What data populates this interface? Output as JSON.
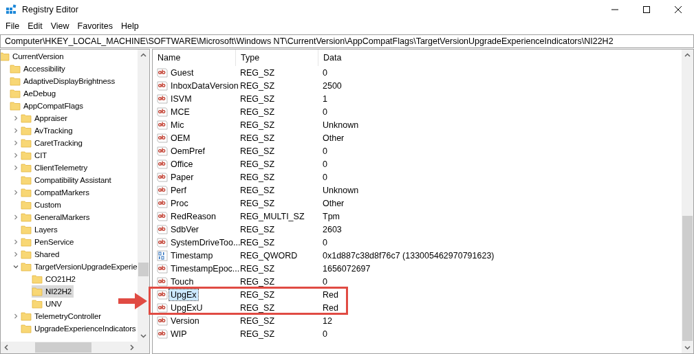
{
  "window": {
    "title": "Registry Editor"
  },
  "menu": [
    "File",
    "Edit",
    "View",
    "Favorites",
    "Help"
  ],
  "address": "Computer\\HKEY_LOCAL_MACHINE\\SOFTWARE\\Microsoft\\Windows NT\\CurrentVersion\\AppCompatFlags\\TargetVersionUpgradeExperienceIndicators\\NI22H2",
  "tree": [
    {
      "label": "CurrentVersion",
      "kind": "plain",
      "selected": false,
      "children": [
        {
          "label": "Accessibility",
          "kind": "plain",
          "selected": false
        },
        {
          "label": "AdaptiveDisplayBrightness",
          "kind": "plain",
          "selected": false
        },
        {
          "label": "AeDebug",
          "kind": "plain",
          "selected": false
        },
        {
          "label": "AppCompatFlags",
          "kind": "plain",
          "selected": false,
          "children": [
            {
              "label": "Appraiser",
              "kind": "branch",
              "expanded": false,
              "selected": false
            },
            {
              "label": "AvTracking",
              "kind": "branch",
              "expanded": false,
              "selected": false
            },
            {
              "label": "CaretTracking",
              "kind": "branch",
              "expanded": false,
              "selected": false
            },
            {
              "label": "CIT",
              "kind": "branch",
              "expanded": false,
              "selected": false
            },
            {
              "label": "ClientTelemetry",
              "kind": "branch",
              "expanded": false,
              "selected": false
            },
            {
              "label": "Compatibility Assistant",
              "kind": "plain",
              "selected": false
            },
            {
              "label": "CompatMarkers",
              "kind": "branch",
              "expanded": false,
              "selected": false
            },
            {
              "label": "Custom",
              "kind": "plain",
              "selected": false
            },
            {
              "label": "GeneralMarkers",
              "kind": "branch",
              "expanded": false,
              "selected": false
            },
            {
              "label": "Layers",
              "kind": "plain",
              "selected": false
            },
            {
              "label": "PenService",
              "kind": "branch",
              "expanded": false,
              "selected": false
            },
            {
              "label": "Shared",
              "kind": "branch",
              "expanded": false,
              "selected": false
            },
            {
              "label": "TargetVersionUpgradeExperie",
              "kind": "branch",
              "expanded": true,
              "selected": false,
              "children": [
                {
                  "label": "CO21H2",
                  "kind": "plain",
                  "selected": false
                },
                {
                  "label": "NI22H2",
                  "kind": "plain",
                  "selected": true
                },
                {
                  "label": "UNV",
                  "kind": "plain",
                  "selected": false
                }
              ]
            },
            {
              "label": "TelemetryController",
              "kind": "branch",
              "expanded": false,
              "selected": false
            },
            {
              "label": "UpgradeExperienceIndicators",
              "kind": "plain",
              "selected": false
            }
          ]
        }
      ]
    }
  ],
  "table": {
    "columns": [
      "Name",
      "Type",
      "Data"
    ],
    "rows": [
      {
        "kind": "string",
        "name": "Guest",
        "type": "REG_SZ",
        "data": "0",
        "selected": false
      },
      {
        "kind": "string",
        "name": "InboxDataVersion",
        "type": "REG_SZ",
        "data": "2500",
        "selected": false
      },
      {
        "kind": "string",
        "name": "ISVM",
        "type": "REG_SZ",
        "data": "1",
        "selected": false
      },
      {
        "kind": "string",
        "name": "MCE",
        "type": "REG_SZ",
        "data": "0",
        "selected": false
      },
      {
        "kind": "string",
        "name": "Mic",
        "type": "REG_SZ",
        "data": "Unknown",
        "selected": false
      },
      {
        "kind": "string",
        "name": "OEM",
        "type": "REG_SZ",
        "data": "Other",
        "selected": false
      },
      {
        "kind": "string",
        "name": "OemPref",
        "type": "REG_SZ",
        "data": "0",
        "selected": false
      },
      {
        "kind": "string",
        "name": "Office",
        "type": "REG_SZ",
        "data": "0",
        "selected": false
      },
      {
        "kind": "string",
        "name": "Paper",
        "type": "REG_SZ",
        "data": "0",
        "selected": false
      },
      {
        "kind": "string",
        "name": "Perf",
        "type": "REG_SZ",
        "data": "Unknown",
        "selected": false
      },
      {
        "kind": "string",
        "name": "Proc",
        "type": "REG_SZ",
        "data": "Other",
        "selected": false
      },
      {
        "kind": "string",
        "name": "RedReason",
        "type": "REG_MULTI_SZ",
        "data": "Tpm",
        "selected": false
      },
      {
        "kind": "string",
        "name": "SdbVer",
        "type": "REG_SZ",
        "data": "2603",
        "selected": false
      },
      {
        "kind": "string",
        "name": "SystemDriveToo...",
        "type": "REG_SZ",
        "data": "0",
        "selected": false
      },
      {
        "kind": "binary",
        "name": "Timestamp",
        "type": "REG_QWORD",
        "data": "0x1d887c38d8f76c7 (133005462970791623)",
        "selected": false
      },
      {
        "kind": "string",
        "name": "TimestampEpoc...",
        "type": "REG_SZ",
        "data": "1656072697",
        "selected": false
      },
      {
        "kind": "string",
        "name": "Touch",
        "type": "REG_SZ",
        "data": "0",
        "selected": false
      },
      {
        "kind": "string",
        "name": "UpgEx",
        "type": "REG_SZ",
        "data": "Red",
        "selected": true
      },
      {
        "kind": "string",
        "name": "UpgExU",
        "type": "REG_SZ",
        "data": "Red",
        "selected": false
      },
      {
        "kind": "string",
        "name": "Version",
        "type": "REG_SZ",
        "data": "12",
        "selected": false
      },
      {
        "kind": "string",
        "name": "WIP",
        "type": "REG_SZ",
        "data": "0",
        "selected": false
      }
    ]
  },
  "callout": {
    "frame": true,
    "arrow": true
  }
}
